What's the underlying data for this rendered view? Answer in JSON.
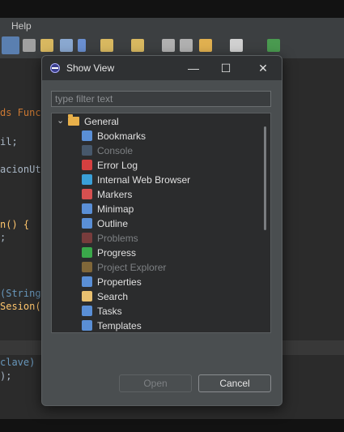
{
  "menubar": {
    "help_label": "Help"
  },
  "editor": {
    "lines": [
      {
        "text": "ds Func",
        "color": "#cc7832"
      },
      {
        "text": "il;",
        "color": "#a9b7c6"
      },
      {
        "text": "acionUt",
        "color": "#a9b7c6"
      },
      {
        "text": "n() {",
        "color": "#ffc66d"
      },
      {
        "text": ";",
        "color": "#a9b7c6"
      },
      {
        "text": "(String",
        "color": "#6897bb"
      },
      {
        "text": "Sesion(",
        "color": "#ffc66d"
      },
      {
        "text": "clave)",
        "color": "#6897bb"
      },
      {
        "text": ");",
        "color": "#a9b7c6"
      }
    ]
  },
  "dialog": {
    "title": "Show View",
    "minimize_glyph": "—",
    "maximize_glyph": "☐",
    "close_glyph": "✕",
    "filter_placeholder": "type filter text",
    "filter_value": "",
    "group": {
      "label": "General",
      "expanded": true
    },
    "items": [
      {
        "label": "Bookmarks",
        "icon": "bookmarks-icon",
        "color": "#5a8fd6",
        "enabled": true
      },
      {
        "label": "Console",
        "icon": "console-icon",
        "color": "#6a8fb8",
        "enabled": false
      },
      {
        "label": "Error Log",
        "icon": "error-log-icon",
        "color": "#d64040",
        "enabled": true
      },
      {
        "label": "Internal Web Browser",
        "icon": "globe-icon",
        "color": "#3aa0d8",
        "enabled": true
      },
      {
        "label": "Markers",
        "icon": "markers-icon",
        "color": "#d65050",
        "enabled": true
      },
      {
        "label": "Minimap",
        "icon": "minimap-icon",
        "color": "#5a8fd6",
        "enabled": true
      },
      {
        "label": "Outline",
        "icon": "outline-icon",
        "color": "#5a8fd6",
        "enabled": true
      },
      {
        "label": "Problems",
        "icon": "problems-icon",
        "color": "#d65050",
        "enabled": false
      },
      {
        "label": "Progress",
        "icon": "progress-icon",
        "color": "#3aa84a",
        "enabled": true
      },
      {
        "label": "Project Explorer",
        "icon": "project-explorer-icon",
        "color": "#e8b04a",
        "enabled": false
      },
      {
        "label": "Properties",
        "icon": "properties-icon",
        "color": "#5a8fd6",
        "enabled": true
      },
      {
        "label": "Search",
        "icon": "search-icon",
        "color": "#e8c070",
        "enabled": true
      },
      {
        "label": "Tasks",
        "icon": "tasks-icon",
        "color": "#5a8fd6",
        "enabled": true
      },
      {
        "label": "Templates",
        "icon": "templates-icon",
        "color": "#5a8fd6",
        "enabled": true
      }
    ],
    "open_label": "Open",
    "cancel_label": "Cancel"
  }
}
